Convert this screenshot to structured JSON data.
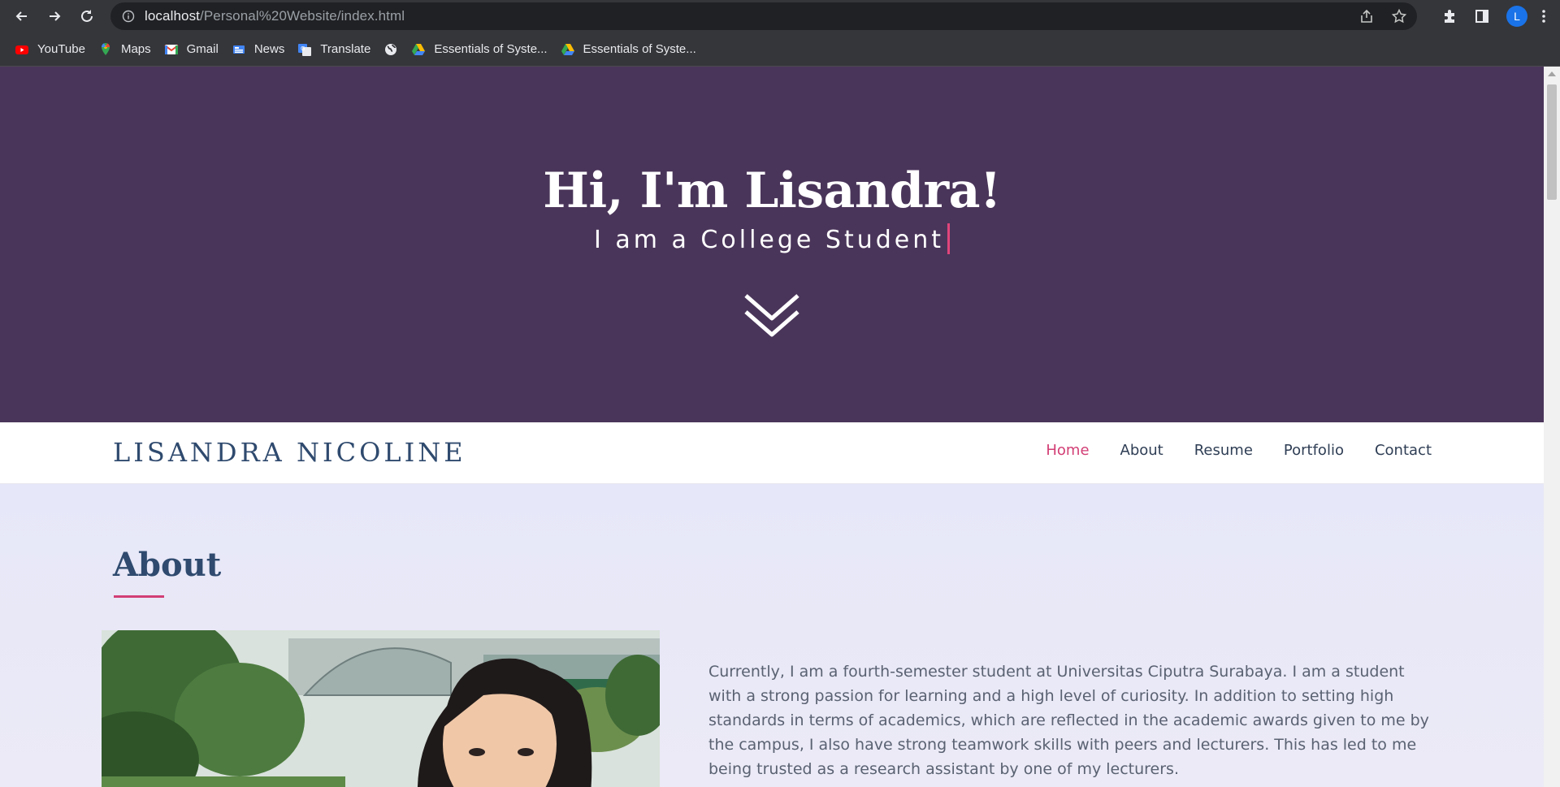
{
  "browser": {
    "url_host": "localhost",
    "url_path": "/Personal%20Website/index.html",
    "profile_initial": "L",
    "bookmarks": [
      {
        "label": "YouTube",
        "icon": "youtube-icon"
      },
      {
        "label": "Maps",
        "icon": "maps-icon"
      },
      {
        "label": "Gmail",
        "icon": "gmail-icon"
      },
      {
        "label": "News",
        "icon": "news-icon"
      },
      {
        "label": "Translate",
        "icon": "translate-icon"
      },
      {
        "label": "",
        "icon": "globe-icon"
      },
      {
        "label": "Essentials of Syste...",
        "icon": "drive-icon"
      },
      {
        "label": "Essentials of Syste...",
        "icon": "drive-icon"
      }
    ]
  },
  "hero": {
    "title": "Hi, I'm Lisandra!",
    "subtitle": "I am a College Student",
    "background": "#4a355a"
  },
  "navbar": {
    "brand": "LISANDRA NICOLINE",
    "items": [
      {
        "label": "Home",
        "active": true
      },
      {
        "label": "About",
        "active": false
      },
      {
        "label": "Resume",
        "active": false
      },
      {
        "label": "Portfolio",
        "active": false
      },
      {
        "label": "Contact",
        "active": false
      }
    ],
    "accent": "#d23e74"
  },
  "about": {
    "title": "About",
    "text": "Currently, I am a fourth-semester student at Universitas Ciputra Surabaya. I am a student with a strong passion for learning and a high level of curiosity. In addition to setting high standards in terms of academics, which are reflected in the academic awards given to me by the campus, I also have strong teamwork skills with peers and lecturers. This has led to me being trusted as a research assistant by one of my lecturers."
  }
}
